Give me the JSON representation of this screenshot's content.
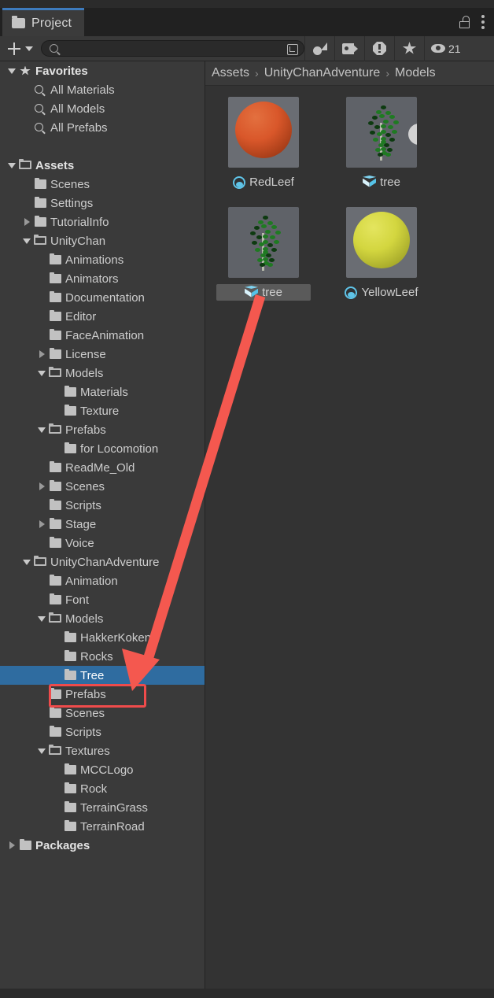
{
  "window": {
    "tab_label": "Project",
    "tab_icon": "folder-icon",
    "lock_icon": "unlocked-padlock-icon",
    "menu_icon": "kebab-menu-icon"
  },
  "toolbar": {
    "add_label": "+",
    "add_icon": "plus-icon",
    "add_dropdown_icon": "chevron-down-icon",
    "search": {
      "value": "",
      "placeholder": "",
      "icon": "search-icon",
      "expand_icon": "open-in-new-window-icon"
    },
    "filters": [
      {
        "name": "filter-by-type",
        "icon": "shape-filter-icon"
      },
      {
        "name": "filter-by-label",
        "icon": "tag-icon"
      },
      {
        "name": "filter-by-error",
        "icon": "warning-octagon-icon"
      },
      {
        "name": "filter-by-favorite",
        "icon": "star-icon"
      }
    ],
    "visible_count": "21",
    "visible_icon": "eye-icon"
  },
  "breadcrumb": {
    "separator": "›",
    "items": [
      "Assets",
      "UnityChanAdventure",
      "Models"
    ]
  },
  "sidebar": {
    "rows": [
      {
        "label": "Favorites",
        "indent": 0,
        "twisty": "down",
        "icon": "star",
        "bold": true,
        "selected": false
      },
      {
        "label": "All Materials",
        "indent": 1,
        "twisty": "none",
        "icon": "search",
        "bold": false,
        "selected": false
      },
      {
        "label": "All Models",
        "indent": 1,
        "twisty": "none",
        "icon": "search",
        "bold": false,
        "selected": false
      },
      {
        "label": "All Prefabs",
        "indent": 1,
        "twisty": "none",
        "icon": "search",
        "bold": false,
        "selected": false
      },
      {
        "label": "",
        "indent": 0,
        "twisty": "none",
        "icon": "none",
        "bold": false,
        "selected": false
      },
      {
        "label": "Assets",
        "indent": 0,
        "twisty": "down",
        "icon": "folderopen",
        "bold": true,
        "selected": false
      },
      {
        "label": "Scenes",
        "indent": 1,
        "twisty": "none",
        "icon": "folder",
        "bold": false,
        "selected": false
      },
      {
        "label": "Settings",
        "indent": 1,
        "twisty": "none",
        "icon": "folder",
        "bold": false,
        "selected": false
      },
      {
        "label": "TutorialInfo",
        "indent": 1,
        "twisty": "right",
        "icon": "folder",
        "bold": false,
        "selected": false
      },
      {
        "label": "UnityChan",
        "indent": 1,
        "twisty": "down",
        "icon": "folderopen",
        "bold": false,
        "selected": false
      },
      {
        "label": "Animations",
        "indent": 2,
        "twisty": "none",
        "icon": "folder",
        "bold": false,
        "selected": false
      },
      {
        "label": "Animators",
        "indent": 2,
        "twisty": "none",
        "icon": "folder",
        "bold": false,
        "selected": false
      },
      {
        "label": "Documentation",
        "indent": 2,
        "twisty": "none",
        "icon": "folder",
        "bold": false,
        "selected": false
      },
      {
        "label": "Editor",
        "indent": 2,
        "twisty": "none",
        "icon": "folder",
        "bold": false,
        "selected": false
      },
      {
        "label": "FaceAnimation",
        "indent": 2,
        "twisty": "none",
        "icon": "folder",
        "bold": false,
        "selected": false
      },
      {
        "label": "License",
        "indent": 2,
        "twisty": "right",
        "icon": "folder",
        "bold": false,
        "selected": false
      },
      {
        "label": "Models",
        "indent": 2,
        "twisty": "down",
        "icon": "folderopen",
        "bold": false,
        "selected": false
      },
      {
        "label": "Materials",
        "indent": 3,
        "twisty": "none",
        "icon": "folder",
        "bold": false,
        "selected": false
      },
      {
        "label": "Texture",
        "indent": 3,
        "twisty": "none",
        "icon": "folder",
        "bold": false,
        "selected": false
      },
      {
        "label": "Prefabs",
        "indent": 2,
        "twisty": "down",
        "icon": "folderopen",
        "bold": false,
        "selected": false
      },
      {
        "label": "for Locomotion",
        "indent": 3,
        "twisty": "none",
        "icon": "folder",
        "bold": false,
        "selected": false
      },
      {
        "label": "ReadMe_Old",
        "indent": 2,
        "twisty": "none",
        "icon": "folder",
        "bold": false,
        "selected": false
      },
      {
        "label": "Scenes",
        "indent": 2,
        "twisty": "right",
        "icon": "folder",
        "bold": false,
        "selected": false
      },
      {
        "label": "Scripts",
        "indent": 2,
        "twisty": "none",
        "icon": "folder",
        "bold": false,
        "selected": false
      },
      {
        "label": "Stage",
        "indent": 2,
        "twisty": "right",
        "icon": "folder",
        "bold": false,
        "selected": false
      },
      {
        "label": "Voice",
        "indent": 2,
        "twisty": "none",
        "icon": "folder",
        "bold": false,
        "selected": false
      },
      {
        "label": "UnityChanAdventure",
        "indent": 1,
        "twisty": "down",
        "icon": "folderopen",
        "bold": false,
        "selected": false
      },
      {
        "label": "Animation",
        "indent": 2,
        "twisty": "none",
        "icon": "folder",
        "bold": false,
        "selected": false
      },
      {
        "label": "Font",
        "indent": 2,
        "twisty": "none",
        "icon": "folder",
        "bold": false,
        "selected": false
      },
      {
        "label": "Models",
        "indent": 2,
        "twisty": "down",
        "icon": "folderopen",
        "bold": false,
        "selected": false
      },
      {
        "label": "HakkerKoken",
        "indent": 3,
        "twisty": "none",
        "icon": "folder",
        "bold": false,
        "selected": false
      },
      {
        "label": "Rocks",
        "indent": 3,
        "twisty": "none",
        "icon": "folder",
        "bold": false,
        "selected": false
      },
      {
        "label": "Tree",
        "indent": 3,
        "twisty": "none",
        "icon": "folder",
        "bold": false,
        "selected": true
      },
      {
        "label": "Prefabs",
        "indent": 2,
        "twisty": "none",
        "icon": "folder",
        "bold": false,
        "selected": false
      },
      {
        "label": "Scenes",
        "indent": 2,
        "twisty": "none",
        "icon": "folder",
        "bold": false,
        "selected": false
      },
      {
        "label": "Scripts",
        "indent": 2,
        "twisty": "none",
        "icon": "folder",
        "bold": false,
        "selected": false
      },
      {
        "label": "Textures",
        "indent": 2,
        "twisty": "down",
        "icon": "folderopen",
        "bold": false,
        "selected": false
      },
      {
        "label": "MCCLogo",
        "indent": 3,
        "twisty": "none",
        "icon": "folder",
        "bold": false,
        "selected": false
      },
      {
        "label": "Rock",
        "indent": 3,
        "twisty": "none",
        "icon": "folder",
        "bold": false,
        "selected": false
      },
      {
        "label": "TerrainGrass",
        "indent": 3,
        "twisty": "none",
        "icon": "folder",
        "bold": false,
        "selected": false
      },
      {
        "label": "TerrainRoad",
        "indent": 3,
        "twisty": "none",
        "icon": "folder",
        "bold": false,
        "selected": false
      },
      {
        "label": "Packages",
        "indent": 0,
        "twisty": "right",
        "icon": "folder",
        "bold": true,
        "selected": false
      }
    ]
  },
  "assets": {
    "items": [
      {
        "label": "RedLeef",
        "kind": "material",
        "icon": "material-sphere-icon",
        "selected": false,
        "has_expand": false
      },
      {
        "label": "tree",
        "kind": "prefab",
        "icon": "prefab-cube-icon",
        "selected": false,
        "has_expand": true
      },
      {
        "label": "tree",
        "kind": "prefab",
        "icon": "prefab-cube-icon",
        "selected": true,
        "has_expand": false
      },
      {
        "label": "YellowLeef",
        "kind": "material",
        "icon": "material-sphere-icon",
        "selected": false,
        "has_expand": false
      }
    ]
  },
  "annotations": {
    "highlight_color": "#ef4b4b",
    "box_target": "Prefabs",
    "arrow_from": "tree",
    "arrow_to": "Prefabs"
  },
  "colors": {
    "selection_blue": "#2f6ca0",
    "tab_accent": "#3d7bbd",
    "sidebar_bg": "#3a3a3a",
    "content_bg": "#333333",
    "annotation_red": "#ef4b4b"
  }
}
